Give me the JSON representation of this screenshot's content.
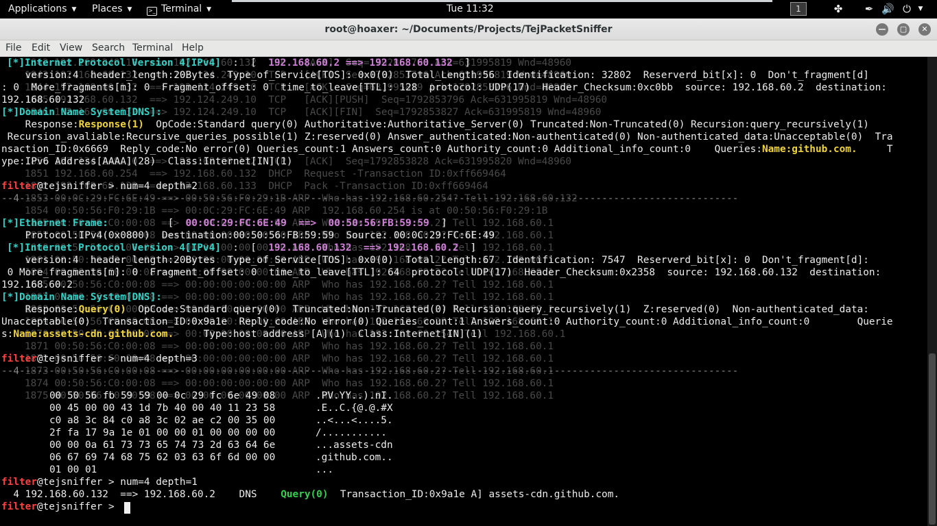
{
  "topbar": {
    "applications": "Applications",
    "places": "Places",
    "terminal": "Terminal",
    "clock": "Tue 11:32",
    "workspace": "1",
    "icons": [
      "apps-icon",
      "pen-icon",
      "volume-icon",
      "power-icon"
    ]
  },
  "window": {
    "title": "root@hoaxer: ~/Documents/Projects/TejPacketSniffer",
    "controls": [
      "minimize",
      "maximize",
      "close"
    ]
  },
  "menu": [
    "File",
    "Edit",
    "View",
    "Search",
    "Terminal",
    "Help"
  ],
  "colors": {
    "cyan": "#34d1c6",
    "pink": "#d07fd8",
    "yellow": "#f1d53b",
    "green": "#33d14d",
    "red": "#ff4040"
  },
  "term": {
    "bg_lines": [
      "1842 192.168.249.10  ==> 192.168.60.132  TCP   [ACK]  Seq=1792853796 Ack=631995819 Wnd=48960",
      "1843 192.168.60.132  ==> 192.124.249.10  TCP   [ACK]  Seq=1792853796 Ack=631995819 Wnd=48960",
      "1844 192.168.60.132  ==> 192.124.249.10  TCP   [ACK]  Seq=631995819 Ack=1792853796 Wnd=48960",
      "1845 192.168.60.132  ==> 192.124.249.10  TCP   [ACK][PUSH]  Seq=1792853796 Ack=631995819 Wnd=48960",
      "1846 192.168.60.132  ==> 192.124.249.10  TCP   [ACK][FIN]  Seq=1792853827 Ack=631995819 Wnd=48960",
      "1850 192.124.249.10  ==> 192.168.60.132  TCP   [ACK]  Seq=1792853828 Ack=631995820 Wnd=48960",
      "1851 192.168.60.254  ==> 192.168.60.132  DHCP  Request -Transaction ID:0xff669464",
      "1852 192.168.60.132  ==> 192.168.60.133  DHCP  Pack -Transaction ID:0xff669464",
      "1853 00:0C:29:FC:6E:49 ==> 00:50:56:F0:29:1B ARP  Who has 192.168.60.254? Tell 192.168.60.132",
      "1854 00:50:56:F0:29:1B ==> 00:0C:29:FC:6E:49 ARP  192.168.60.254 is at 00:50:56:F0:29:1B",
      "1855 00:50:56:C0:00:08 ==> 00:00:00:00:00:00 ARP  Who has 192.168.60.2? Tell 192.168.60.1",
      "1857 00:50:56:C0:00:08 ==> 00:00:00:00:00:00 ARP  Who has 192.168.60.2? Tell 192.168.60.1",
      "1860 00:50:56:C0:00:08 ==> 00:00:00:00:00:00 ARP  Who has 192.168.60.2? Tell 192.168.60.1",
      "1861 00:50:56:C0:00:08 ==> 00:00:00:00:00:00 ARP  Who has 192.168.60.2? Tell 192.168.60.1",
      "1864 00:50:56:C0:00:08 ==> 00:00:00:00:00:00 ARP  Who has 192.168.60.2? Tell 192.168.60.1",
      "1865 00:50:56:C0:00:08 ==> 00:00:00:00:00:00 ARP  Who has 192.168.60.2? Tell 192.168.60.1",
      "1867 00:50:56:C0:00:08 ==> 00:00:00:00:00:00 ARP  Who has 192.168.60.2? Tell 192.168.60.1",
      "1868 00:50:56:C0:00:08 ==> 00:00:00:00:00:00 ARP  Who has 192.168.60.2? Tell 192.168.60.1",
      "1869 00:50:56:C0:00:08 ==> 00:00:00:00:00:00 ARP  Who has 192.168.60.2? Tell 192.168.60.1",
      "1870 00:50:56:C0:00:08 ==> 00:00:00:00:00:00 ARP  Who has 192.168.60.254? Tell 192.168.60.1",
      "1871 00:50:56:C0:00:08 ==> 00:00:00:00:00:00 ARP  Who has 192.168.60.2? Tell 192.168.60.1",
      "1872 00:50:56:C0:00:08 ==> 00:00:00:00:00:00 ARP  Who has 192.168.60.2? Tell 192.168.60.1",
      "1873 00:50:56:C0:00:08 ==> 00:00:00:00:00:00 ARP  Who has 192.168.60.2? Tell 192.168.60.1",
      "1874 00:50:56:C0:00:08 ==> 00:00:00:00:00:00 ARP  Who has 192.168.60.2? Tell 192.168.60.1",
      "1875 00:50:56:C0:00:08 ==> 00:00:00:00:00:00 ARP  Who has 192.168.60.2? Tell 192.168.60.1"
    ],
    "ipv4_header": "[*]Internet Protocol Version 4[IPv4]",
    "dns_header": "[*]Domain Name System[DNS]:",
    "eth_header": "[*]Ethernet Frame:",
    "arrow": "==>",
    "pkt1": {
      "src": "192.168.60.2",
      "dst": "192.168.60.132",
      "ip1": "    version:4  header_length:20Bytes  Type_of_Service[TOS]: 0x0(0)  Total_Length:56  Identification: 32802  Reserverd_bit[x]: 0  Don't_fragment[d]",
      "ip2": ": 0  More_fragments[m]: 0  Fragment_offset: 0  time_to_leave[TTL]: 128  protocol: UDP(17)  Header_Checksum:0xc0bb  source: 192.168.60.2  destination:",
      "ip3": "192.168.60.132",
      "dns_resp_label": "    Response:",
      "dns_resp_val": "Response(1)",
      "dns1": "  OpCode:Standard query(0) Authoritative:Authoritative_Server(0) Truncated:Non-Truncated(0) Recursion:query_recursively(1)",
      "dns2": " Recursion_avaliable:Recursive_queries_possible(1) Z:reserved(0) Answer_authenticated:Non-authenticated(0) Non-authenticated_data:Unacceptable(0)  Tra",
      "dns3a": "nsaction_ID:0x6669  Reply_code:No error(0) Queries_count:1 Answers_count:0 Authority_count:0 Additional_info_count:0    Queries:",
      "dns3b": "Name:github.com.",
      "dns3c": "     T",
      "dns4": "ype:IPv6 Address[AAAA](28)  Class:Internet[IN](1)"
    },
    "prompt_user": "filter",
    "prompt_host": "@tejsniffer > ",
    "cmd1": "num=4 depth=2",
    "sep": "--4-------------------------------------------------------------------------------------------------------------------------",
    "pkt2": {
      "eth_src": "00:0C:29:FC:6E:49",
      "eth_dst": "00:50:56:FB:59:59",
      "eth_detail": "    Protocol:IPv4(0x0800)  Destination:00:50:56:FB:59:59  Source: 00:0C:29:FC:6E:49",
      "src": "192.168.60.132",
      "dst": "192.168.60.2",
      "ip1": "    version:4  header_length:20Bytes  Type_of_Service[TOS]: 0x0(0)  Total_Length:67  Identification: 7547  Reserverd_bit[x]: 0  Don't_fragment[d]:",
      "ip2": " 0 More_fragments[m]: 0  Fragment_offset: 0  time_to_leave[TTL]: 64  protocol: UDP(17)  Header_Checksum:0x2358  source: 192.168.60.132  destination:",
      "ip3": "192.168.60.2",
      "dns_q_label": "    Response:",
      "dns_q_val": "Query(0)",
      "dns1": "  OpCode:Standard query(0)  Truncated:Non-Truncated(0) Recursion:query_recursively(1)  Z:reserved(0)  Non-authenticated_data:",
      "dns2": "Unacceptable(0)  Transaction_ID:0x9a1e  Reply_code:No error(0) Queries_count:1 Answers_count:0 Authority_count:0 Additional_info_count:0        Querie",
      "dns3a": "s:",
      "dns3b": "Name:assets-cdn.github.com.",
      "dns3c": "     Type:host address [A](1)  Class:Internet[IN](1)"
    },
    "cmd2": "num=4 depth=3",
    "hexdump": [
      [
        "00 50 56 fb 59 59 00 0c 29 fc 6e 49 08",
        ".PV.YY..).nI."
      ],
      [
        "00 45 00 00 43 1d 7b 40 00 40 11 23 58",
        ".E..C.{@.@.#X"
      ],
      [
        "c0 a8 3c 84 c0 a8 3c 02 ae c2 00 35 00",
        "..<...<....5."
      ],
      [
        "2f fa 17 9a 1e 01 00 00 01 00 00 00 00",
        "/..........."
      ],
      [
        "00 00 0a 61 73 73 65 74 73 2d 63 64 6e",
        "...assets-cdn"
      ],
      [
        "06 67 69 74 68 75 62 03 63 6f 6d 00 00",
        ".github.com.."
      ],
      [
        "01 00 01",
        "..."
      ]
    ],
    "cmd3": "num=4 depth=1",
    "summary_a": "  4 192.168.60.132  ==> 192.168.60.2    DNS    ",
    "summary_b": "Query(0)",
    "summary_c": "  Transaction_ID:0x9a1e A] assets-cdn.github.com."
  }
}
